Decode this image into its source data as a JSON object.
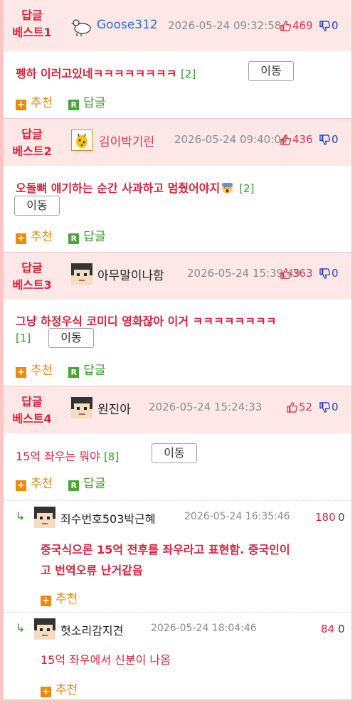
{
  "best_label_line1": "답글",
  "labels": {
    "recommend": "추천",
    "reply": "답글",
    "move": "이동",
    "plus": "+",
    "r": "R",
    "arrow": "↳"
  },
  "colors": {
    "best": "#d8233c",
    "up": "#e2344f",
    "down": "#1f3fb5",
    "recommend": "#e08a13",
    "reply": "#3c9b2e",
    "header_bg": "#fde7e7",
    "frame": "#f9c5c5"
  },
  "comments": [
    {
      "best": "베스트1",
      "user": "Goose312",
      "user_color": "#2f6fd3",
      "avatar_icon": "goose-avatar-icon",
      "date": "2026-05-24 09:32:58",
      "up": "469",
      "down": "0",
      "text": "펭하 이러고있네ㅋㅋㅋㅋㅋㅋㅋㅋ",
      "count": "[2]"
    },
    {
      "best": "베스트2",
      "user": "김이박기린",
      "user_color": "#e2344f",
      "avatar_icon": "giraffe-avatar-icon",
      "date": "2026-05-24 09:40:04",
      "up": "436",
      "down": "0",
      "text": "오돌뼈 얘기하는 순간 사과하고 멈췄어야지",
      "count": "[2]"
    },
    {
      "best": "베스트3",
      "user": "아무말이나함",
      "user_color": "#222222",
      "avatar_icon": "pixel-face-avatar-icon",
      "date": "2026-05-24 15:39:49",
      "up": "363",
      "down": "0",
      "text": "그냥 하정우식 코미디 영화잖아 이거 ㅋㅋㅋㅋㅋㅋㅋㅋ",
      "count": "[1]"
    },
    {
      "best": "베스트4",
      "user": "원진아",
      "user_color": "#222222",
      "avatar_icon": "pixel-face-avatar-icon",
      "date": "2026-05-24 15:24:33",
      "up": "52",
      "down": "0",
      "text": "15억 좌우는 뭐야",
      "count": "[8]"
    }
  ],
  "replies": [
    {
      "user": "죄수번호503박근혜",
      "date": "2026-05-24 16:35:46",
      "up": "180",
      "down": "0",
      "line1": "중국식으론 15억 전후를 좌우라고 표현함. 중국인이",
      "line2": "고 번역오류 난거같음"
    },
    {
      "user": "헛소리감지견",
      "date": "2026-05-24 18:04:46",
      "up": "84",
      "down": "0",
      "line1": "15억 좌우에서 신분이 나옴"
    }
  ]
}
